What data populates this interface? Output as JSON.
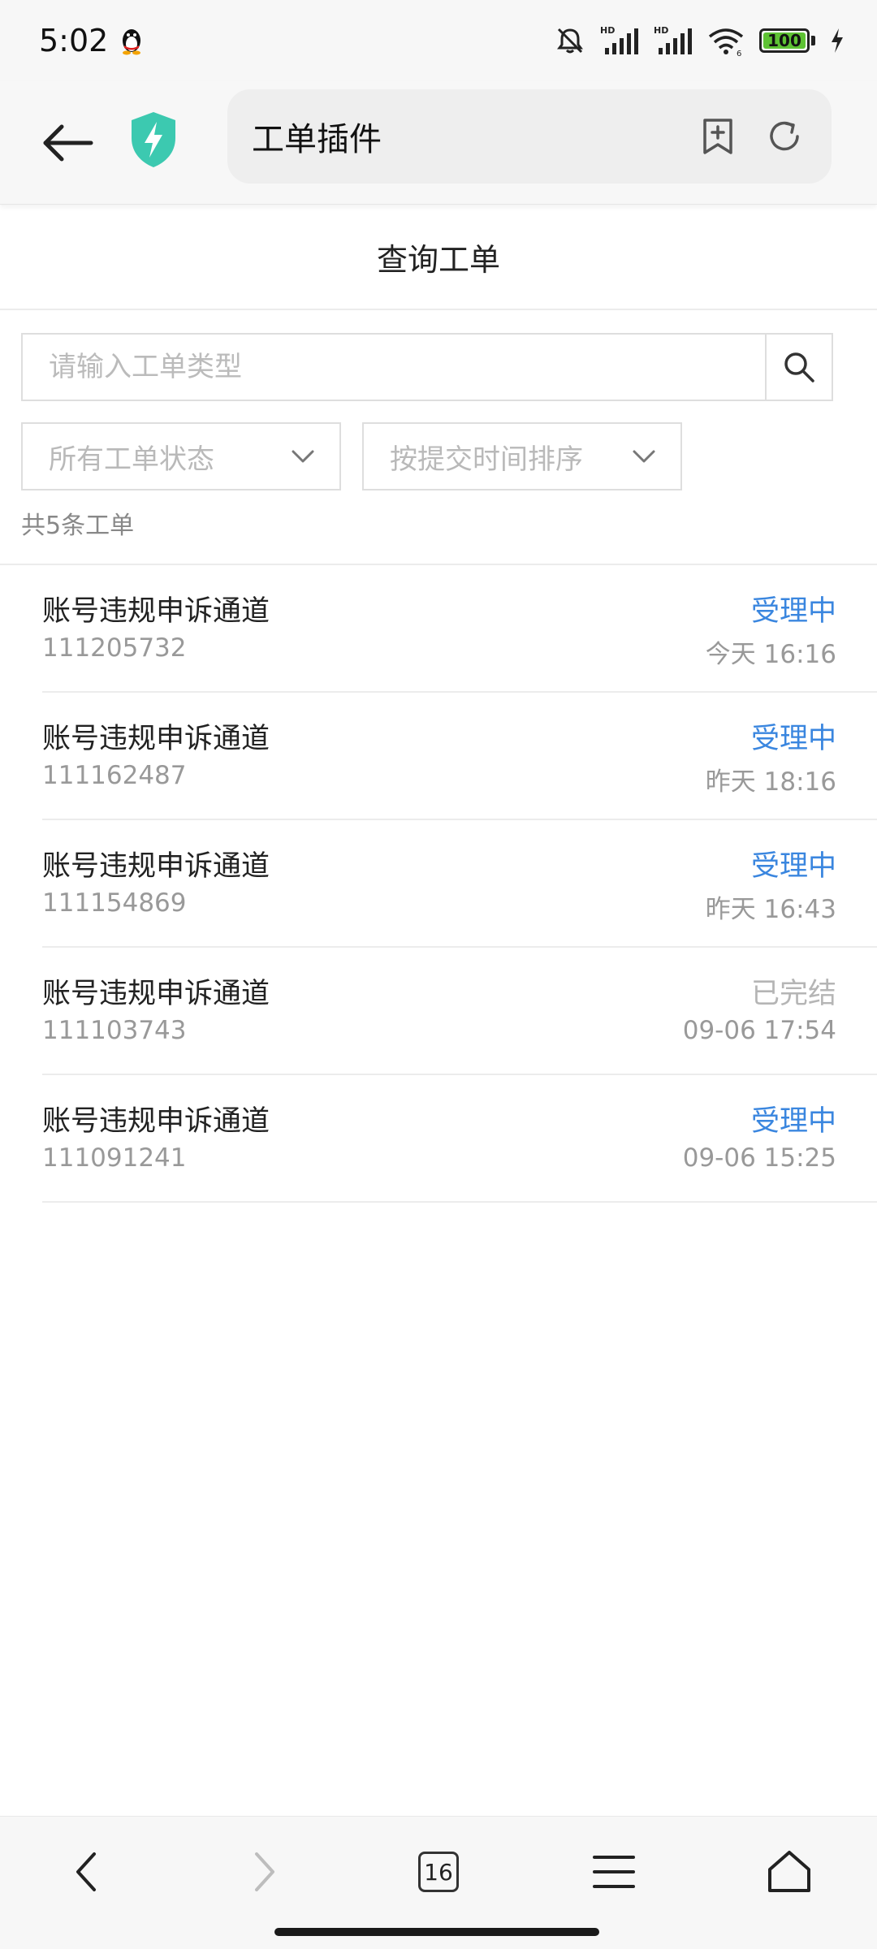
{
  "status_bar": {
    "time": "5:02",
    "battery": "100",
    "icons": [
      "qq-penguin-icon",
      "mute-bell-icon",
      "hd-signal-icon",
      "hd-signal-icon",
      "wifi-6-icon",
      "battery-icon",
      "charging-bolt-icon"
    ],
    "battery_color": "#5ec234"
  },
  "browser": {
    "title": "工单插件",
    "icons": [
      "back-arrow-icon",
      "shield-bolt-icon",
      "add-bookmark-icon",
      "refresh-icon"
    ],
    "shield_color": "#3cc9b0"
  },
  "page": {
    "title": "查询工单"
  },
  "search": {
    "placeholder": "请输入工单类型",
    "icon": "search-icon"
  },
  "filters": {
    "status_label": "所有工单状态",
    "sort_label": "按提交时间排序"
  },
  "count_text": "共5条工单",
  "accent_color": "#3a86df",
  "tickets": [
    {
      "title": "账号违规申诉通道",
      "id": "111205732",
      "status": "受理中",
      "time": "今天 16:16"
    },
    {
      "title": "账号违规申诉通道",
      "id": "111162487",
      "status": "受理中",
      "time": "昨天 18:16"
    },
    {
      "title": "账号违规申诉通道",
      "id": "111154869",
      "status": "受理中",
      "time": "昨天 16:43"
    },
    {
      "title": "账号违规申诉通道",
      "id": "111103743",
      "status": "已完结",
      "time": "09-06 17:54"
    },
    {
      "title": "账号违规申诉通道",
      "id": "111091241",
      "status": "受理中",
      "time": "09-06 15:25"
    }
  ],
  "bottom_nav": {
    "tab_count": "16",
    "icons": [
      "nav-back-icon",
      "nav-forward-icon",
      "tabs-icon",
      "menu-icon",
      "home-icon"
    ]
  }
}
